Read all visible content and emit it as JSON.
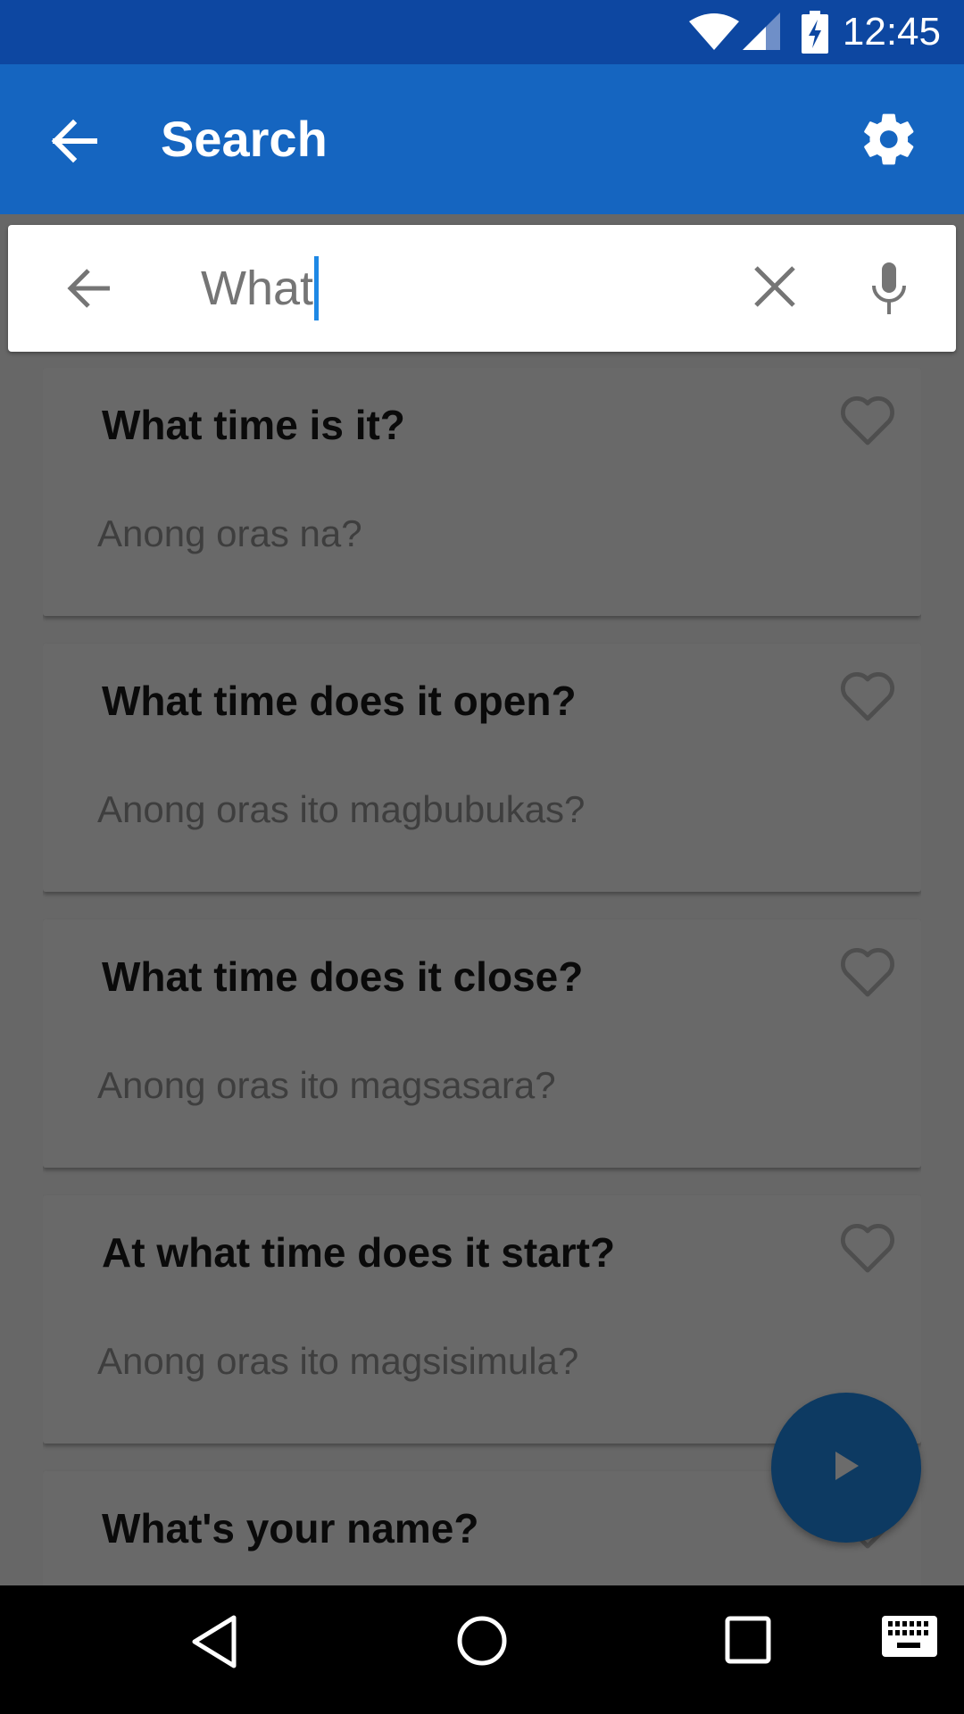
{
  "status_bar": {
    "time": "12:45",
    "icons": [
      "wifi-icon",
      "cell-signal-icon",
      "battery-charging-icon"
    ]
  },
  "app_bar": {
    "title": "Search",
    "back_icon": "arrow-back-icon",
    "settings_icon": "gear-icon",
    "background": "#1565c0"
  },
  "search": {
    "query": "What",
    "back_icon": "arrow-back-icon",
    "clear_icon": "close-icon",
    "voice_icon": "mic-icon"
  },
  "results": [
    {
      "phrase": "What time is it?",
      "translation": "Anong oras na?",
      "favorite": false
    },
    {
      "phrase": "What time does it open?",
      "translation": "Anong oras ito magbubukas?",
      "favorite": false
    },
    {
      "phrase": "What time does it close?",
      "translation": "Anong oras ito magsasara?",
      "favorite": false
    },
    {
      "phrase": "At what time does it start?",
      "translation": "Anong oras ito magsisimula?",
      "favorite": false
    },
    {
      "phrase": "What's your name?",
      "translation": "",
      "favorite": false
    }
  ],
  "fab": {
    "icon": "play-icon",
    "color": "#0d3a62"
  },
  "nav_bar": {
    "buttons": [
      "back",
      "home",
      "recents",
      "keyboard"
    ]
  }
}
